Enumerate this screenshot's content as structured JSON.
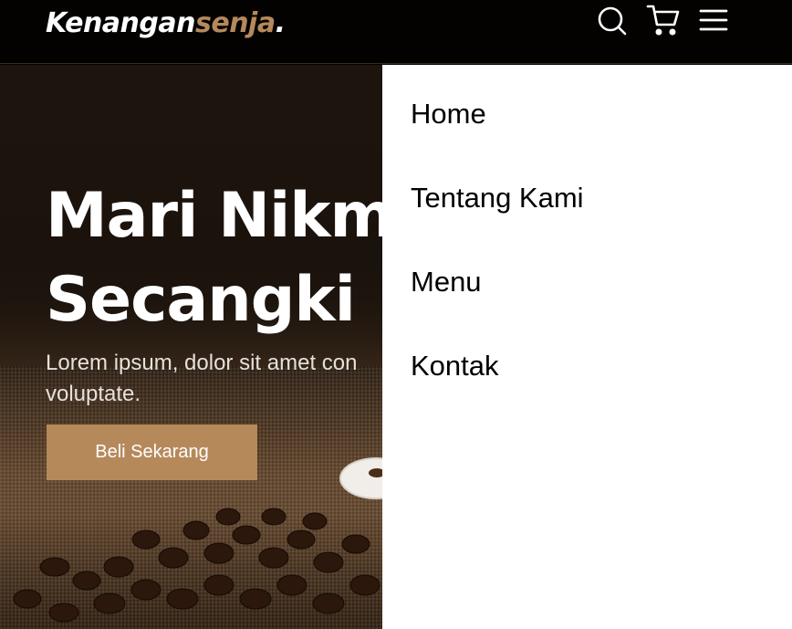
{
  "navbar": {
    "brand": {
      "part1": "Kenangan",
      "part2": "senja",
      "suffix": "."
    },
    "icons": [
      "search-icon",
      "shopping-cart-icon",
      "hamburger-menu-icon"
    ]
  },
  "hero": {
    "title_line1": "Mari Nikm",
    "title_line2": "Secangki",
    "text_line1": "Lorem ipsum, dolor sit amet con",
    "text_line2": "voluptate.",
    "cta_label": "Beli Sekarang"
  },
  "menu": {
    "items": [
      {
        "label": "Home"
      },
      {
        "label": "Tentang Kami"
      },
      {
        "label": "Menu"
      },
      {
        "label": "Kontak"
      }
    ]
  },
  "colors": {
    "accent": "#b6895b",
    "navbar_bg": "#030201",
    "menu_bg": "#ffffff",
    "text_light": "#ffffff"
  }
}
